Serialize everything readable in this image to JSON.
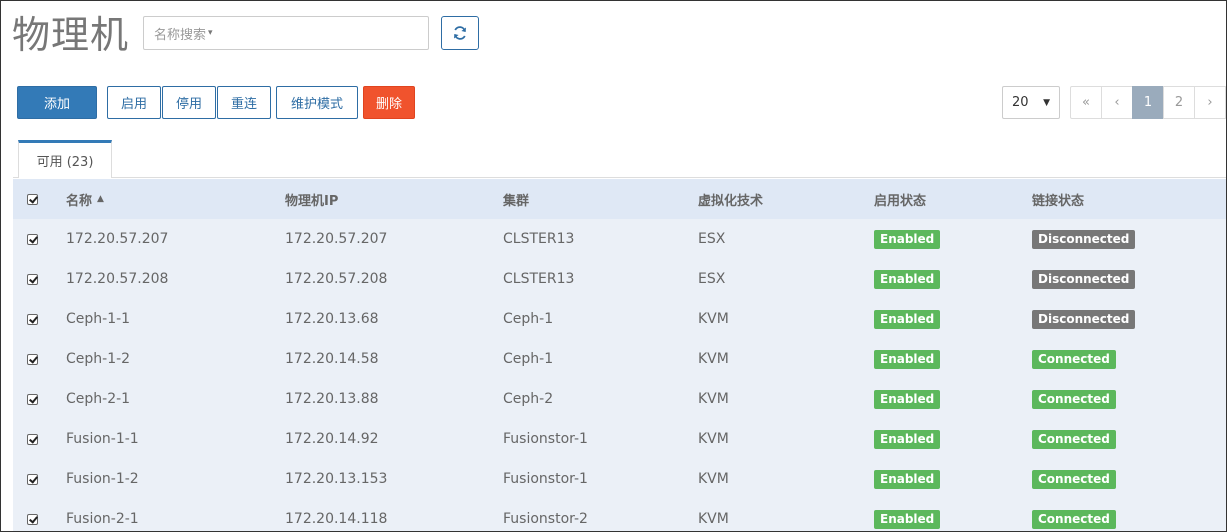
{
  "page_title": "物理机",
  "search": {
    "placeholder": "名称搜索",
    "caret": "▾"
  },
  "toolbar": {
    "add": "添加",
    "enable": "启用",
    "disable": "停用",
    "reconnect": "重连",
    "maintenance": "维护模式",
    "delete": "删除"
  },
  "pagination": {
    "page_size": "20",
    "first": "«",
    "prev": "‹",
    "pages": [
      "1",
      "2"
    ],
    "next": "›"
  },
  "tab": {
    "label": "可用 (23)"
  },
  "table": {
    "headers": {
      "name": "名称",
      "ip": "物理机IP",
      "cluster": "集群",
      "virt": "虚拟化技术",
      "state": "启用状态",
      "conn": "链接状态"
    },
    "rows": [
      {
        "name": "172.20.57.207",
        "ip": "172.20.57.207",
        "cluster": "CLSTER13",
        "virt": "ESX",
        "state": "Enabled",
        "conn": "Disconnected"
      },
      {
        "name": "172.20.57.208",
        "ip": "172.20.57.208",
        "cluster": "CLSTER13",
        "virt": "ESX",
        "state": "Enabled",
        "conn": "Disconnected"
      },
      {
        "name": "Ceph-1-1",
        "ip": "172.20.13.68",
        "cluster": "Ceph-1",
        "virt": "KVM",
        "state": "Enabled",
        "conn": "Disconnected"
      },
      {
        "name": "Ceph-1-2",
        "ip": "172.20.14.58",
        "cluster": "Ceph-1",
        "virt": "KVM",
        "state": "Enabled",
        "conn": "Connected"
      },
      {
        "name": "Ceph-2-1",
        "ip": "172.20.13.88",
        "cluster": "Ceph-2",
        "virt": "KVM",
        "state": "Enabled",
        "conn": "Connected"
      },
      {
        "name": "Fusion-1-1",
        "ip": "172.20.14.92",
        "cluster": "Fusionstor-1",
        "virt": "KVM",
        "state": "Enabled",
        "conn": "Connected"
      },
      {
        "name": "Fusion-1-2",
        "ip": "172.20.13.153",
        "cluster": "Fusionstor-1",
        "virt": "KVM",
        "state": "Enabled",
        "conn": "Connected"
      },
      {
        "name": "Fusion-2-1",
        "ip": "172.20.14.118",
        "cluster": "Fusionstor-2",
        "virt": "KVM",
        "state": "Enabled",
        "conn": "Connected"
      }
    ]
  },
  "colors": {
    "primary": "#337ab7",
    "danger": "#f0532d",
    "success": "#5cb85c",
    "muted": "#777777"
  }
}
